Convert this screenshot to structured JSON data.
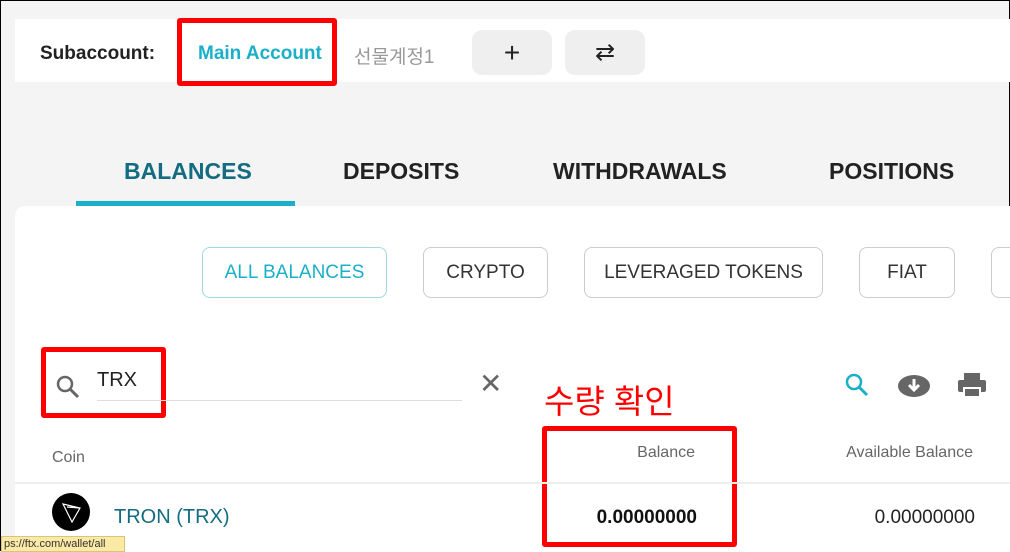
{
  "subaccount": {
    "label": "Subaccount:",
    "accounts": [
      "Main Account",
      "선물계정1"
    ],
    "add_icon": "plus-icon",
    "switch_icon": "swap-icon"
  },
  "tabs": [
    "BALANCES",
    "DEPOSITS",
    "WITHDRAWALS",
    "POSITIONS"
  ],
  "filters": [
    "ALL BALANCES",
    "CRYPTO",
    "LEVERAGED TOKENS",
    "FIAT"
  ],
  "search": {
    "value": "TRX",
    "icon": "search-icon",
    "clear_icon": "close-icon"
  },
  "annotation": "수량 확인",
  "toolbar": {
    "icons": [
      "search-icon",
      "download-icon",
      "print-icon"
    ]
  },
  "table": {
    "columns": [
      "Coin",
      "Balance",
      "Available Balance"
    ],
    "rows": [
      {
        "coin": "TRON (TRX)",
        "balance": "0.00000000",
        "available": "0.00000000"
      }
    ]
  },
  "status_bar": "ps://ftx.com/wallet/all",
  "colors": {
    "accent": "#1ab0c8",
    "annotation": "#ff0000"
  }
}
